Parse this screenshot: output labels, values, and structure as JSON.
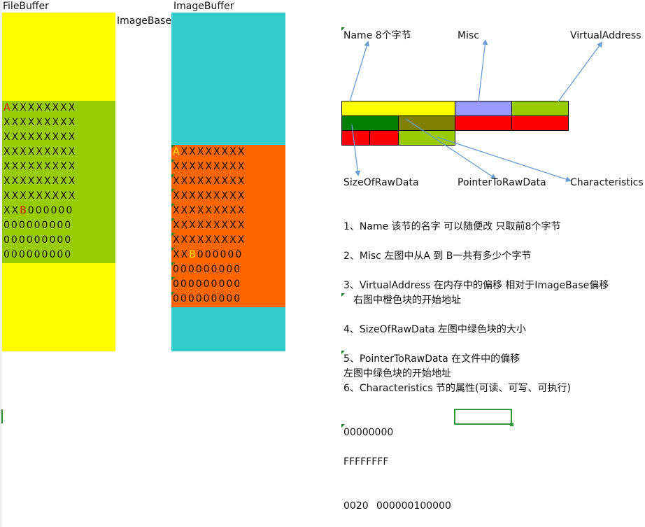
{
  "labels": {
    "file_buffer": "FileBuffer",
    "image_buffer": "ImageBuffer",
    "image_base": "ImageBase"
  },
  "file_rows": [
    {
      "pre": "",
      "mark": "A",
      "post": "XXXXXXXX"
    },
    {
      "pre": "XXXXXXXXX",
      "mark": "",
      "post": ""
    },
    {
      "pre": "XXXXXXXXX",
      "mark": "",
      "post": ""
    },
    {
      "pre": "XXXXXXXXX",
      "mark": "",
      "post": ""
    },
    {
      "pre": "XXXXXXXXX",
      "mark": "",
      "post": ""
    },
    {
      "pre": "XXXXXXXXX",
      "mark": "",
      "post": ""
    },
    {
      "pre": "XXXXXXXXX",
      "mark": "",
      "post": ""
    },
    {
      "pre": "XX",
      "mark": "B",
      "post": "000000"
    },
    {
      "pre": "000000000",
      "mark": "",
      "post": ""
    },
    {
      "pre": "000000000",
      "mark": "",
      "post": ""
    },
    {
      "pre": "000000000",
      "mark": "",
      "post": ""
    }
  ],
  "image_rows": [
    {
      "pre": "",
      "mark": "A",
      "post": "XXXXXXXX"
    },
    {
      "pre": "XXXXXXXXX",
      "mark": "",
      "post": ""
    },
    {
      "pre": "XXXXXXXXX",
      "mark": "",
      "post": ""
    },
    {
      "pre": "XXXXXXXXX",
      "mark": "",
      "post": ""
    },
    {
      "pre": "XXXXXXXXX",
      "mark": "",
      "post": ""
    },
    {
      "pre": "XXXXXXXXX",
      "mark": "",
      "post": ""
    },
    {
      "pre": "XXXXXXXXX",
      "mark": "",
      "post": ""
    },
    {
      "pre": "XX",
      "mark": "B",
      "post": "000000"
    },
    {
      "pre": "000000000",
      "mark": "",
      "post": ""
    },
    {
      "pre": "000000000",
      "mark": "",
      "post": ""
    },
    {
      "pre": "000000000",
      "mark": "",
      "post": ""
    }
  ],
  "header_labels": {
    "name": "Name 8个字节",
    "misc": "Misc",
    "virtual_address": "VirtualAddress",
    "size_of_raw_data": "SizeOfRawData",
    "pointer_to_raw_data": "PointerToRawData",
    "characteristics": "Characteristics"
  },
  "notes": {
    "n1": "1、Name 该节的名字 可以随便改 只取前8个字节",
    "n2": "2、Misc 左图中从A 到 B一共有多少个字节",
    "n3": "3、VirtualAddress 在内存中的偏移 相对于ImageBase偏移",
    "n3b": "右图中橙色块的开始地址",
    "n4": "4、SizeOfRawData 左图中绿色块的大小",
    "n5": "5、PointerToRawData 在文件中的偏移",
    "n5b": "左图中绿色块的开始地址",
    "n6": "6、Characteristics 节的属性(可读、可写、可执行)"
  },
  "values": {
    "v1": "00000000",
    "v2": "FFFFFFFF",
    "v3a": "0020",
    "v3b": "000000100000"
  },
  "colors": {
    "yellow": "#ffff00",
    "cyan": "#33cccc",
    "green": "#99cc00",
    "orange": "#ff6600",
    "lavender": "#9999ff",
    "dark_green": "#008000",
    "olive": "#808000",
    "red": "#ff0000"
  }
}
